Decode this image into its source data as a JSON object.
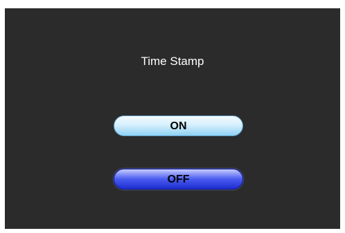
{
  "dialog": {
    "title": "Time Stamp",
    "options": [
      {
        "label": "ON",
        "selected": false
      },
      {
        "label": "OFF",
        "selected": true
      }
    ]
  },
  "colors": {
    "background": "#2b2b2b",
    "title_text": "#ffffff",
    "on_button": "#8fd2f4",
    "off_button_selected": "#1d2dd0"
  }
}
